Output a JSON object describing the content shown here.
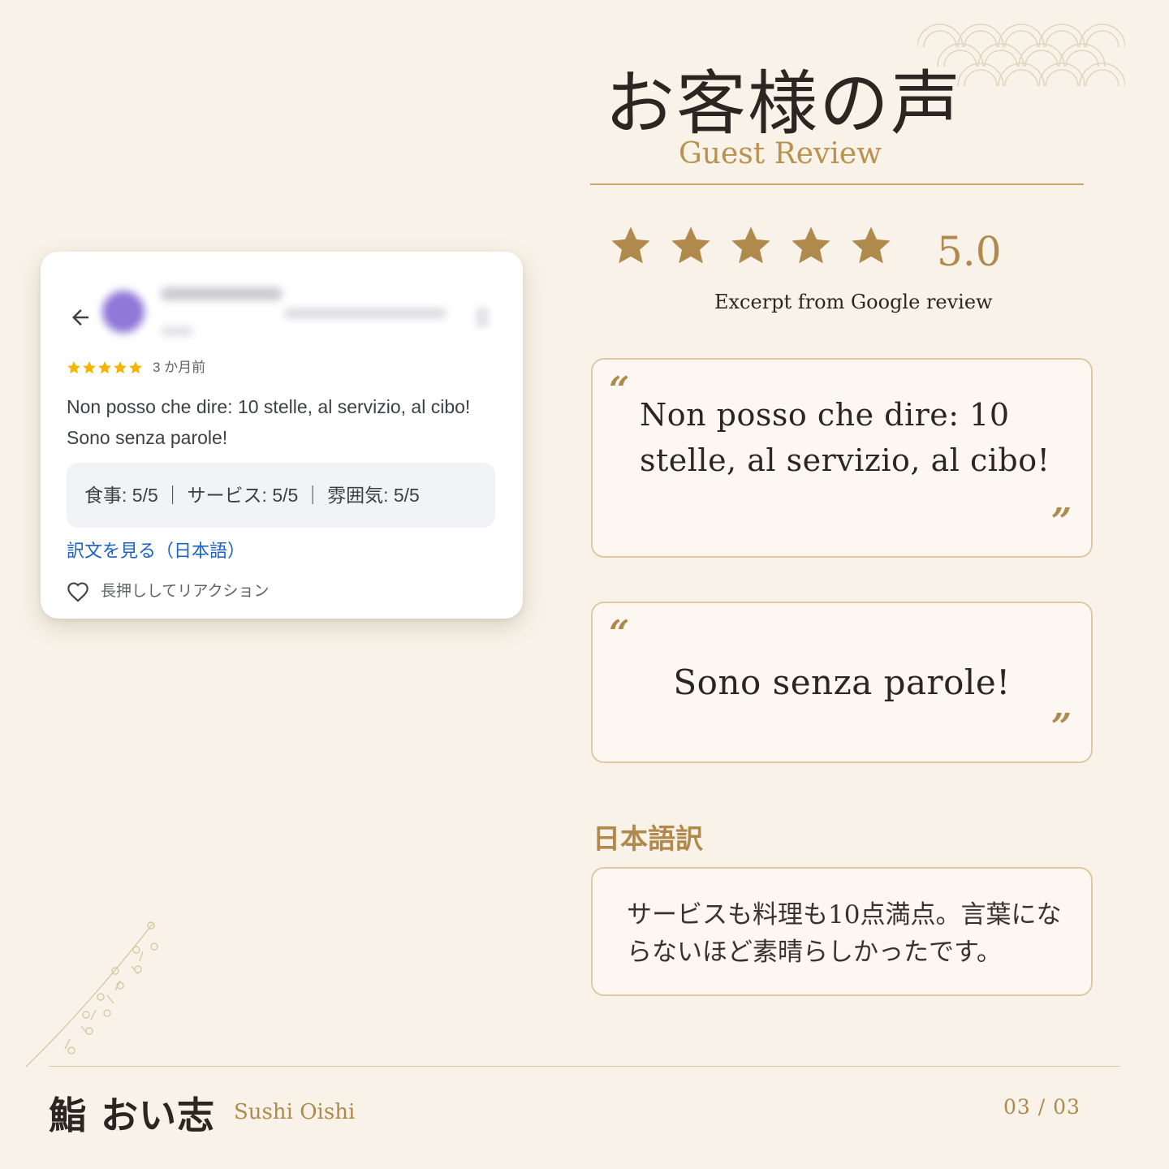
{
  "header": {
    "title_ja": "お客様の声",
    "title_en": "Guest Review"
  },
  "rating": {
    "stars": 5,
    "max_stars": 5,
    "value": "5.0",
    "source_note": "Excerpt from Google review"
  },
  "quotes": [
    {
      "text": "Non posso che dire: 10 stelle, al servizio, al cibo!"
    },
    {
      "text": "Sono senza parole!"
    }
  ],
  "quote_marks": {
    "open": "“",
    "close": "”"
  },
  "translation": {
    "label": "日本語訳",
    "text": "サービスも料理も10点満点。言葉にならないほど素晴らしかったです。"
  },
  "google_review": {
    "stars": 5,
    "time_ago": "3 か月前",
    "review_text": "Non posso che dire: 10 stelle, al servizio, al cibo! Sono senza parole!",
    "scores": "食事: 5/5 ｜ サービス: 5/5 ｜ 雰囲気: 5/5",
    "translate_link": "訳文を見る（日本語）",
    "reaction_hint": "長押ししてリアクション",
    "icons": {
      "back": "back-arrow-icon",
      "heart": "heart-icon",
      "star": "star-icon"
    }
  },
  "footer": {
    "brand_ja": "鮨 おい志",
    "brand_en": "Sushi Oishi",
    "page": "03 / 03"
  },
  "colors": {
    "background": "#f8f2e8",
    "gold": "#b08a4c",
    "star_gold": "#b08a4c",
    "google_star": "#f4b400",
    "link_blue": "#1a62c4"
  }
}
